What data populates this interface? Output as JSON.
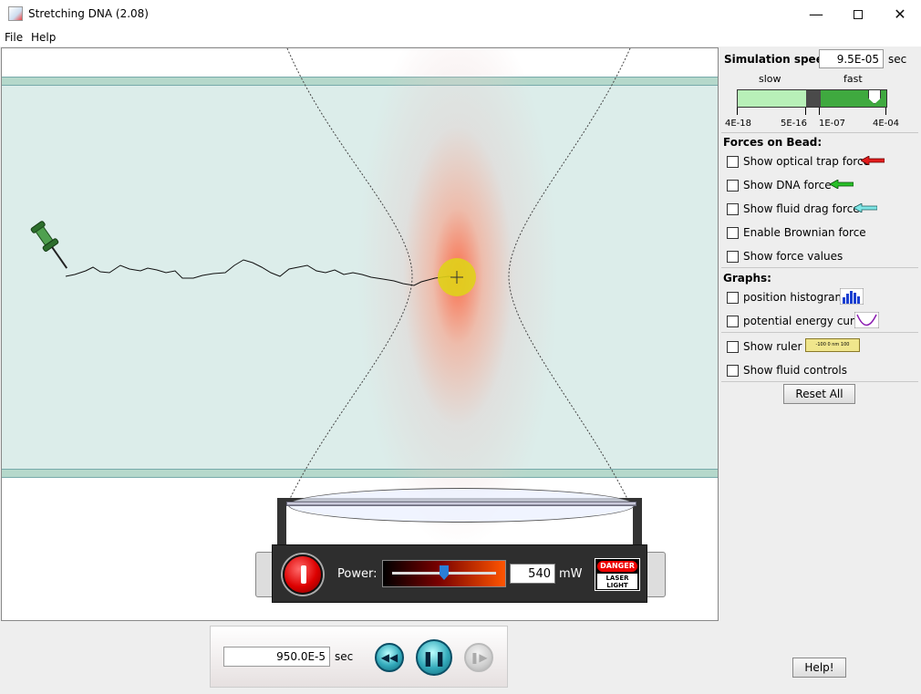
{
  "window": {
    "title": "Stretching DNA (2.08)"
  },
  "menu": {
    "file": "File",
    "help": "Help"
  },
  "laser": {
    "power_label": "Power:",
    "power_value": "540",
    "power_unit": "mW",
    "power_fraction": 0.5,
    "danger_top": "DANGER",
    "danger_bottom": "LASER LIGHT"
  },
  "clock": {
    "time_value": "950.0E-5",
    "time_unit": "sec"
  },
  "simulation_speed": {
    "label": "Simulation speed:",
    "value": "9.5E-05",
    "unit": "sec",
    "slow_label": "slow",
    "fast_label": "fast",
    "ticks": [
      "4E-18",
      "5E-16",
      "1E-07",
      "4E-04"
    ]
  },
  "forces": {
    "heading": "Forces on Bead:",
    "items": [
      {
        "label": "Show optical trap force",
        "arrow_color": "#e21b1b"
      },
      {
        "label": "Show DNA force",
        "arrow_color": "#28c028"
      },
      {
        "label": "Show fluid drag force",
        "arrow_color": "#7fe6e6"
      },
      {
        "label": "Enable Brownian force"
      },
      {
        "label": "Show force values"
      }
    ]
  },
  "graphs": {
    "heading": "Graphs:",
    "items": [
      {
        "label": "position histogram",
        "icon": "histogram-icon"
      },
      {
        "label": "potential energy curve",
        "icon": "potential-curve-icon"
      }
    ]
  },
  "misc": {
    "items": [
      {
        "label": "Show ruler",
        "icon": "ruler-icon"
      },
      {
        "label": "Show fluid controls"
      }
    ],
    "ruler_text": "-100    0 nm    100"
  },
  "buttons": {
    "reset": "Reset All",
    "help": "Help!"
  },
  "colors": {
    "fluid": "#dcedea",
    "wall": "#b5d8cb",
    "bead": "#e8d81a",
    "laser": "#ff5a32"
  }
}
